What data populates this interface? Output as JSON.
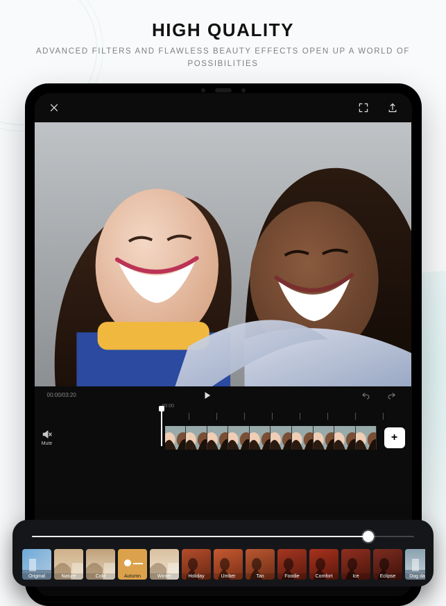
{
  "headline": "HIGH QUALITY",
  "subhead": "ADVANCED FILTERS AND FLAWLESS BEAUTY EFFECTS OPEN UP A WORLD OF POSSIBILITIES",
  "editor": {
    "timecode": "00:00/03:20",
    "ruler_start": "00:00",
    "mute_label": "Mute",
    "add_clip_glyph": "+"
  },
  "slider": {
    "percent": 88
  },
  "filters": [
    {
      "name": "Original",
      "bg": "linear-gradient(135deg,#6da9d8 0%,#b0c9e0 100%)",
      "selected": false
    },
    {
      "name": "Nature",
      "bg": "linear-gradient(#cfb18a,#e4d3b6)",
      "selected": true
    },
    {
      "name": "Cold",
      "bg": "linear-gradient(#bfa17a,#e6d5b9)",
      "selected": false
    },
    {
      "name": "Autumn",
      "bg": "#dca24b",
      "selected": false,
      "icon": true
    },
    {
      "name": "Winter",
      "bg": "linear-gradient(#d9c0a0,#efe3cf)",
      "selected": false
    },
    {
      "name": "Holiday",
      "bg": "linear-gradient(160deg,#b24d2b,#6c2713)",
      "selected": false
    },
    {
      "name": "Umber",
      "bg": "linear-gradient(160deg,#c55a32,#7a2f16)",
      "selected": false
    },
    {
      "name": "Tan",
      "bg": "linear-gradient(160deg,#b95832,#6f2c14)",
      "selected": false
    },
    {
      "name": "Foodie",
      "bg": "linear-gradient(160deg,#a53622,#5c1a0d)",
      "selected": false
    },
    {
      "name": "Comfort",
      "bg": "linear-gradient(160deg,#a8321e,#5a170b)",
      "selected": false
    },
    {
      "name": "Ice",
      "bg": "linear-gradient(160deg,#8f2f21,#4b150a)",
      "selected": false
    },
    {
      "name": "Eclipse",
      "bg": "linear-gradient(160deg,#7d2c20,#3f120a)",
      "selected": false
    },
    {
      "name": "Dog days",
      "bg": "linear-gradient(#8aa2b0,#c6d3da)",
      "selected": false
    }
  ]
}
